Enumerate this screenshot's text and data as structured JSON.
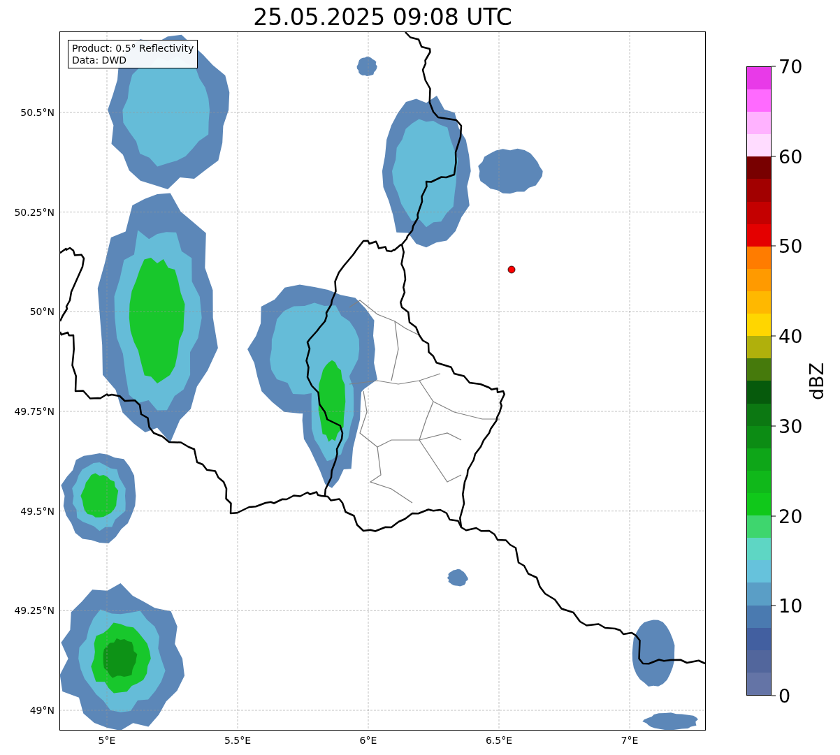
{
  "title": "25.05.2025 09:08 UTC",
  "map": {
    "info_box": [
      "Product: 0.5° Reflectivity",
      "Data: DWD"
    ],
    "y_axis_labels": [
      "50.5°N",
      "50.25°N",
      "50°N",
      "49.75°N",
      "49.5°N",
      "49.25°N",
      "49°N"
    ],
    "x_axis_labels": [
      "5°E",
      "5.5°E",
      "6°E",
      "6.5°E",
      "7°E"
    ]
  },
  "colorbar": {
    "label": "dBZ",
    "ticks": [
      "70",
      "60",
      "50",
      "40",
      "30",
      "20",
      "10",
      "0"
    ],
    "bins": [
      {
        "color": "#6474a6"
      },
      {
        "color": "#52669c"
      },
      {
        "color": "#425fa0"
      },
      {
        "color": "#4a7ab0"
      },
      {
        "color": "#5a9ec6"
      },
      {
        "color": "#66c2dc"
      },
      {
        "color": "#5ed6c4"
      },
      {
        "color": "#3ed66e"
      },
      {
        "color": "#10c81a"
      },
      {
        "color": "#10b81a"
      },
      {
        "color": "#0ea618"
      },
      {
        "color": "#0c8c14"
      },
      {
        "color": "#0c7812"
      },
      {
        "color": "#065a0c"
      },
      {
        "color": "#467a0c"
      },
      {
        "color": "#b0b00c"
      },
      {
        "color": "#ffd600"
      },
      {
        "color": "#ffb800"
      },
      {
        "color": "#ff9a00"
      },
      {
        "color": "#ff7c00"
      },
      {
        "color": "#e40000"
      },
      {
        "color": "#c40000"
      },
      {
        "color": "#a20000"
      },
      {
        "color": "#780000"
      },
      {
        "color": "#ffdcff"
      },
      {
        "color": "#ffb2ff"
      },
      {
        "color": "#ff6aff"
      },
      {
        "color": "#e83ae8"
      }
    ]
  }
}
